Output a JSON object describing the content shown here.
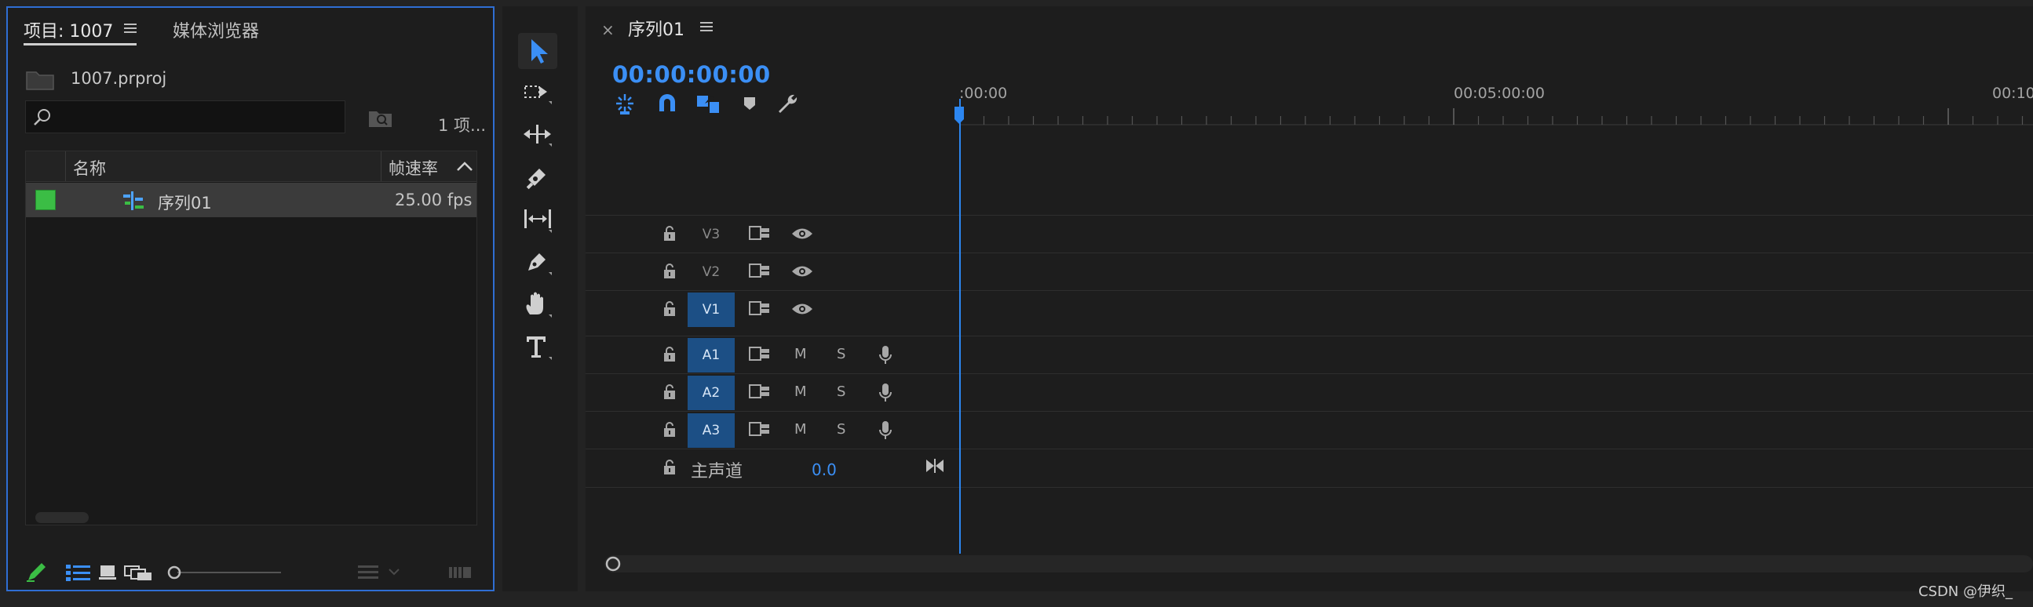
{
  "project_panel": {
    "tab_label": "项目: 1007",
    "media_browser_tab": "媒体浏览器",
    "file_name": "1007.prproj",
    "search": {
      "value": "",
      "placeholder": ""
    },
    "item_count": "1 项...",
    "columns": {
      "name": "名称",
      "fps": "帧速率"
    },
    "rows": [
      {
        "name": "序列01",
        "fps": "25.00 fps",
        "label_color": "#3bbd45"
      }
    ]
  },
  "tools": [
    {
      "name": "selection"
    },
    {
      "name": "track-select-forward"
    },
    {
      "name": "ripple-edit"
    },
    {
      "name": "razor"
    },
    {
      "name": "slip"
    },
    {
      "name": "pen"
    },
    {
      "name": "hand"
    },
    {
      "name": "type"
    }
  ],
  "timeline": {
    "tab_label": "序列01",
    "close_symbol": "×",
    "timecode": "00:00:00:00",
    "ruler_labels": [
      ":00:00",
      "00:05:00:00",
      "00:10"
    ],
    "video_tracks": [
      {
        "id": "V3",
        "active": false
      },
      {
        "id": "V2",
        "active": false
      },
      {
        "id": "V1",
        "active": true
      }
    ],
    "audio_tracks": [
      {
        "id": "A1",
        "m": "M",
        "s": "S"
      },
      {
        "id": "A2",
        "m": "M",
        "s": "S"
      },
      {
        "id": "A3",
        "m": "M",
        "s": "S"
      }
    ],
    "master": {
      "label": "主声道",
      "value": "0.0"
    }
  },
  "colors": {
    "accent": "#2f6ed3",
    "timecode": "#3b8ff5",
    "active_track": "#1c4f85"
  },
  "watermark": "CSDN @伊织_"
}
